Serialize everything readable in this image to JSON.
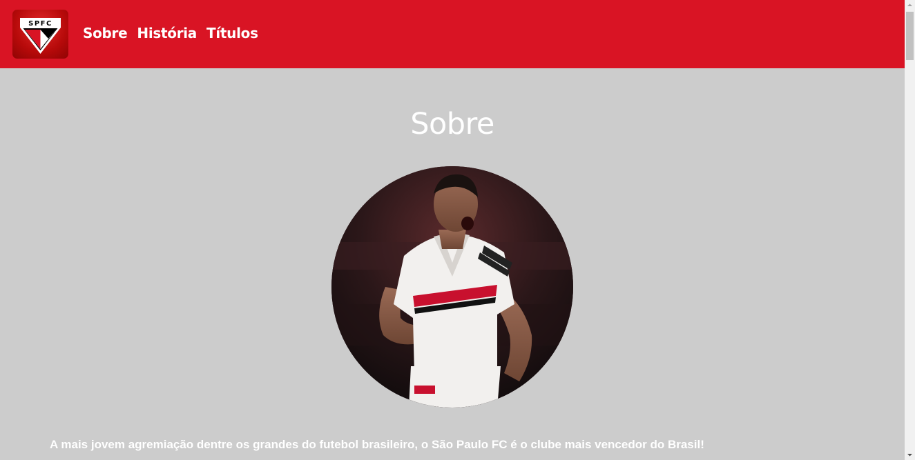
{
  "header": {
    "logo_text": "SPFC",
    "nav": [
      {
        "label": "Sobre"
      },
      {
        "label": "História"
      },
      {
        "label": "Títulos"
      }
    ],
    "background_color": "#d91424"
  },
  "main": {
    "title": "Sobre",
    "photo_icon": "player-photo",
    "about_text": "A mais jovem agremiação dentre os grandes do futebol brasileiro, o São Paulo FC é o clube mais vencedor do Brasil!"
  },
  "scrollbar": {
    "up_icon": "chevron-up-icon",
    "down_icon": "chevron-down-icon"
  }
}
